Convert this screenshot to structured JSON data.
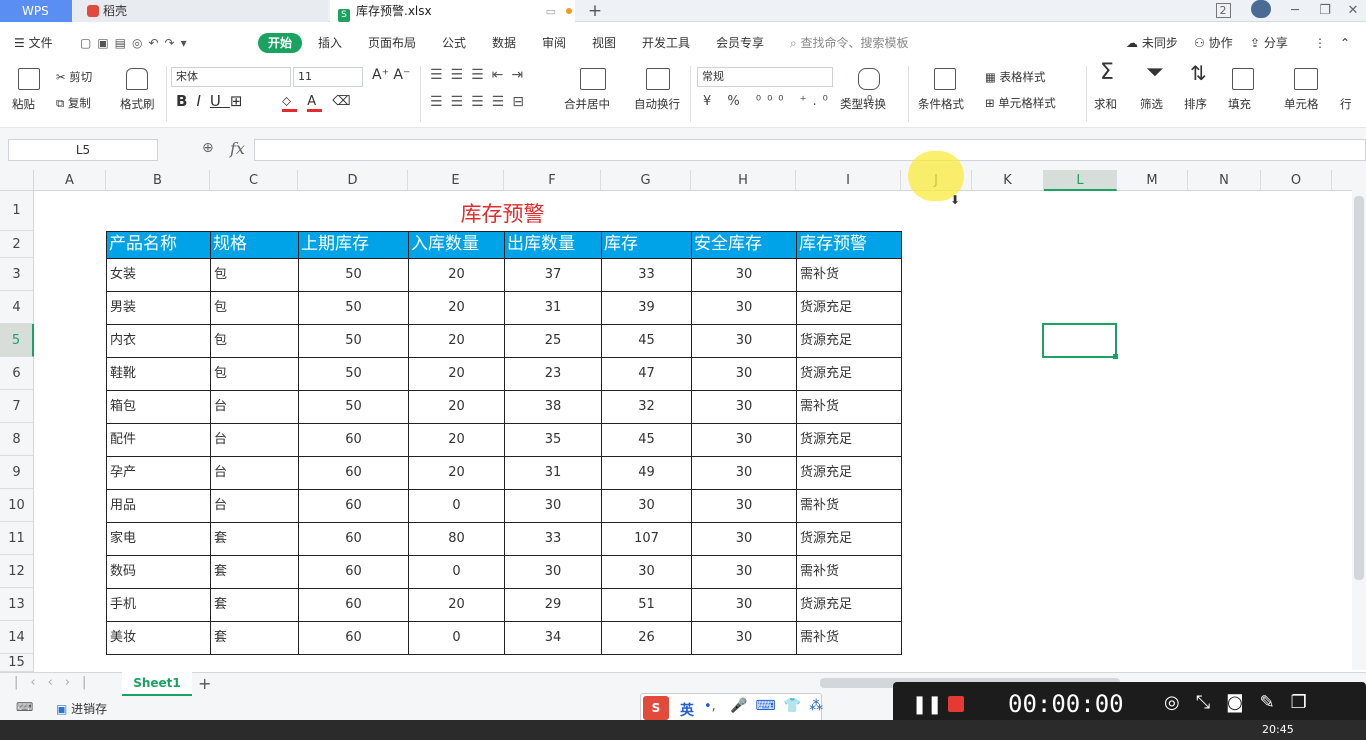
{
  "titlebar": {
    "wps_tab": "WPS",
    "daoke_tab": "稻壳",
    "file_tab": "库存预警.xlsx",
    "plus": "+",
    "notif_count": "2"
  },
  "menu": {
    "file": "文件",
    "start": "开始",
    "items": [
      "插入",
      "页面布局",
      "公式",
      "数据",
      "审阅",
      "视图",
      "开发工具",
      "会员专享"
    ],
    "search": "查找命令、搜索模板",
    "unsync": "未同步",
    "collab": "协作",
    "share": "分享"
  },
  "ribbon": {
    "paste": "粘贴",
    "cut": "剪切",
    "copy": "复制",
    "format_painter": "格式刷",
    "font": "宋体",
    "font_size": "11",
    "merge": "合并居中",
    "wrap": "自动换行",
    "number_format": "常规",
    "type_convert": "类型转换",
    "cond_format": "条件格式",
    "table_style": "表格样式",
    "cell_style": "单元格样式",
    "sum": "求和",
    "filter": "筛选",
    "sort": "排序",
    "fill": "填充",
    "cell": "单元格",
    "row": "行"
  },
  "formula": {
    "name_box": "L5",
    "fx": "fx",
    "value": ""
  },
  "columns": [
    "A",
    "B",
    "C",
    "D",
    "E",
    "F",
    "G",
    "H",
    "I",
    "J",
    "K",
    "L",
    "M",
    "N",
    "O"
  ],
  "rows": [
    "1",
    "2",
    "3",
    "4",
    "5",
    "6",
    "7",
    "8",
    "9",
    "10",
    "11",
    "12",
    "13",
    "14",
    "15"
  ],
  "sheet": {
    "title": "库存预警",
    "headers": [
      "产品名称",
      "规格",
      "上期库存",
      "入库数量",
      "出库数量",
      "库存",
      "安全库存",
      "库存预警"
    ],
    "data": [
      [
        "女装",
        "包",
        "50",
        "20",
        "37",
        "33",
        "30",
        "需补货"
      ],
      [
        "男装",
        "包",
        "50",
        "20",
        "31",
        "39",
        "30",
        "货源充足"
      ],
      [
        "内衣",
        "包",
        "50",
        "20",
        "25",
        "45",
        "30",
        "货源充足"
      ],
      [
        "鞋靴",
        "包",
        "50",
        "20",
        "23",
        "47",
        "30",
        "货源充足"
      ],
      [
        "箱包",
        "台",
        "50",
        "20",
        "38",
        "32",
        "30",
        "需补货"
      ],
      [
        "配件",
        "台",
        "60",
        "20",
        "35",
        "45",
        "30",
        "货源充足"
      ],
      [
        "孕产",
        "台",
        "60",
        "20",
        "31",
        "49",
        "30",
        "货源充足"
      ],
      [
        "用品",
        "台",
        "60",
        "0",
        "30",
        "30",
        "30",
        "需补货"
      ],
      [
        "家电",
        "套",
        "60",
        "80",
        "33",
        "107",
        "30",
        "货源充足"
      ],
      [
        "数码",
        "套",
        "60",
        "0",
        "30",
        "30",
        "30",
        "需补货"
      ],
      [
        "手机",
        "套",
        "60",
        "20",
        "29",
        "51",
        "30",
        "货源充足"
      ],
      [
        "美妆",
        "套",
        "60",
        "0",
        "34",
        "26",
        "30",
        "需补货"
      ]
    ]
  },
  "sheet_tabs": {
    "active": "Sheet1"
  },
  "status": {
    "macro": "进销存"
  },
  "ime": {
    "lang": "英",
    "punct": "•,"
  },
  "recorder": {
    "time": "00:00:00"
  },
  "taskbar": {
    "clock": "20:45"
  },
  "colors": {
    "accent": "#1aa260",
    "header_bg": "#00a2e8",
    "title_red": "#e62a2a"
  }
}
